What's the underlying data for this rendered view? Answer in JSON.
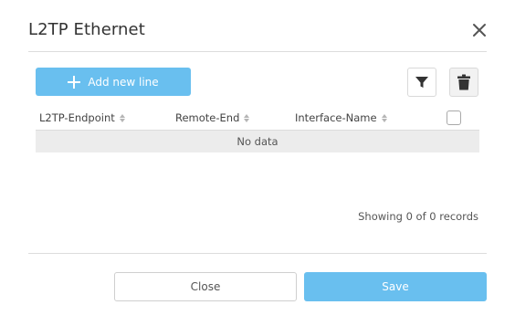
{
  "dialog": {
    "title": "L2TP Ethernet"
  },
  "toolbar": {
    "add_label": "Add new line"
  },
  "table": {
    "columns": [
      {
        "label": "L2TP-Endpoint"
      },
      {
        "label": "Remote-End"
      },
      {
        "label": "Interface-Name"
      }
    ],
    "empty_text": "No data",
    "rows": []
  },
  "footer": {
    "records_text": "Showing 0 of 0 records",
    "close_label": "Close",
    "save_label": "Save"
  },
  "icons": {
    "close": "close-icon",
    "add": "plus-icon",
    "filter": "filter-icon",
    "delete": "trash-icon",
    "sort": "sort-icon"
  },
  "colors": {
    "accent": "#69bfef",
    "divider": "#dcdcdc",
    "empty_row_bg": "#ececec"
  }
}
